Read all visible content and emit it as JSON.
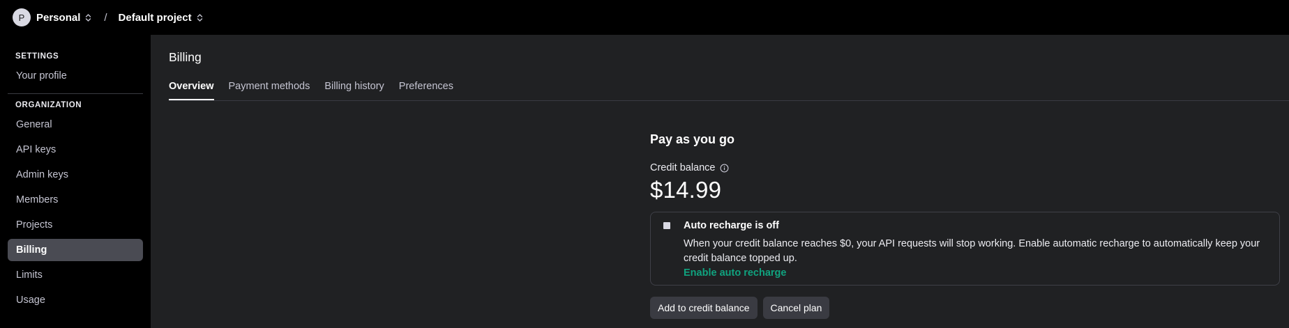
{
  "header": {
    "avatar_initial": "P",
    "org_name": "Personal",
    "separator": "/",
    "project_name": "Default project"
  },
  "sidebar": {
    "settings_heading": "SETTINGS",
    "settings_items": [
      {
        "label": "Your profile"
      }
    ],
    "org_heading": "ORGANIZATION",
    "org_items": [
      {
        "label": "General"
      },
      {
        "label": "API keys"
      },
      {
        "label": "Admin keys"
      },
      {
        "label": "Members"
      },
      {
        "label": "Projects"
      },
      {
        "label": "Billing",
        "active": true
      },
      {
        "label": "Limits"
      },
      {
        "label": "Usage"
      }
    ]
  },
  "main": {
    "title": "Billing",
    "tabs": [
      {
        "label": "Overview",
        "active": true
      },
      {
        "label": "Payment methods"
      },
      {
        "label": "Billing history"
      },
      {
        "label": "Preferences"
      }
    ],
    "plan_name": "Pay as you go",
    "credit_label": "Credit balance",
    "credit_amount": "$14.99",
    "auto_recharge": {
      "title": "Auto recharge is off",
      "description": "When your credit balance reaches $0, your API requests will stop working. Enable automatic recharge to automatically keep your credit balance topped up.",
      "link_label": "Enable auto recharge"
    },
    "buttons": {
      "add_credit": "Add to credit balance",
      "cancel_plan": "Cancel plan"
    }
  },
  "colors": {
    "background": "#000000",
    "panel": "#202123",
    "accent_green": "#10a37f",
    "active_nav": "#4a4b53"
  }
}
